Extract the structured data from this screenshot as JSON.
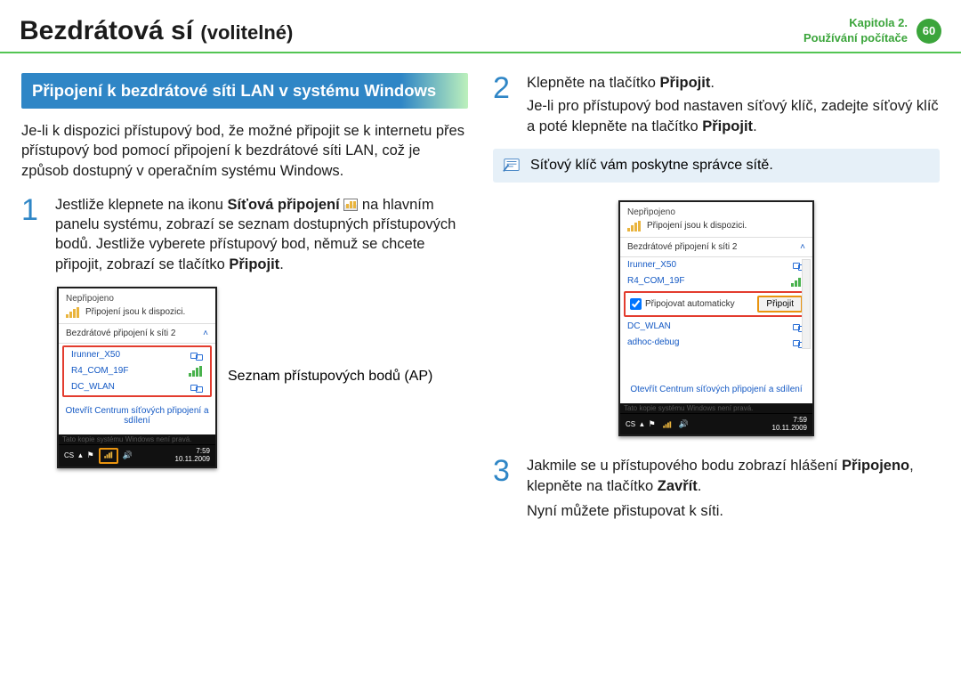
{
  "header": {
    "title_main": "Bezdrátová sí",
    "title_optional": "(volitelné)",
    "chapter_line1": "Kapitola 2.",
    "chapter_line2": "Používání počítače",
    "page_number": "60"
  },
  "section": {
    "heading": "Připojení k bezdrátové síti LAN v systému Windows",
    "intro": "Je-li k dispozici přístupový bod, že možné připojit se k internetu přes přístupový bod pomocí připojení k bezdrátové síti LAN, což je způsob dostupný v operačním systému Windows."
  },
  "steps": {
    "s1_pre": "Jestliže klepnete na ikonu ",
    "s1_bold1": "Síťová připojení",
    "s1_post1": " na hlavním panelu systému, zobrazí se seznam dostupných přístupových bodů. Jestliže vyberete přístupový bod, němuž se chcete připojit, zobrazí se tlačítko ",
    "s1_bold2": "Připojit",
    "s1_post2": ".",
    "s2_line1_pre": "Klepněte na tlačítko ",
    "s2_line1_bold": "Připojit",
    "s2_line1_post": ".",
    "s2_line2_pre": "Je-li pro přístupový bod nastaven síťový klíč, zadejte síťový klíč a poté klepněte na tlačítko ",
    "s2_line2_bold": "Připojit",
    "s2_line2_post": ".",
    "s3_line1_pre": "Jakmile se u přístupového bodu zobrazí hlášení ",
    "s3_line1_bold": "Připojeno",
    "s3_line1_mid": ", klepněte na tlačítko ",
    "s3_line1_bold2": "Zavřít",
    "s3_line1_post": ".",
    "s3_line2": "Nyní můžete přistupovat k síti."
  },
  "note": "Síťový klíč vám poskytne správce sítě.",
  "callout": {
    "ap_list_label": "Seznam přístupových bodů (AP)"
  },
  "popup": {
    "status_title": "Nepřipojeno",
    "status_available": "Připojení jsou k dispozici.",
    "wlan_interface": "Bezdrátové připojení k síti 2",
    "open_center": "Otevřít Centrum síťových připojení a sdílení",
    "auto_connect": "Připojovat automaticky",
    "connect_btn": "Připojit",
    "aps": {
      "a0": "Irunner_X50",
      "a1": "R4_COM_19F",
      "a2": "DC_WLAN",
      "a3": "adhoc-debug"
    }
  },
  "taskbar": {
    "lang": "CS",
    "time": "7:59",
    "date": "10.11.2009",
    "ghost": "Tato kopie systému Windows není pravá."
  }
}
